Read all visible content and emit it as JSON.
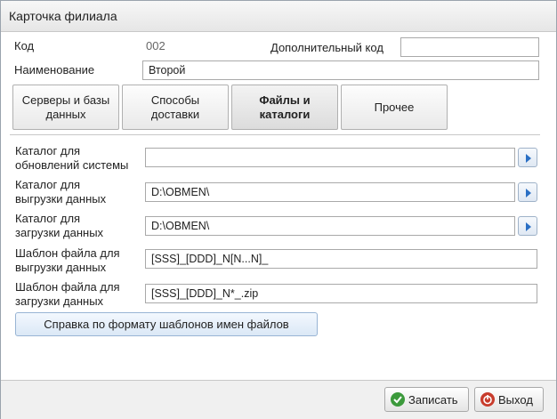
{
  "window": {
    "title": "Карточка филиала"
  },
  "header": {
    "code_label": "Код",
    "code_value": "002",
    "extra_code_label": "Дополнительный код",
    "extra_code_value": "",
    "name_label": "Наименование",
    "name_value": "Второй"
  },
  "tabs": [
    {
      "label_line1": "Серверы и базы",
      "label_line2": "данных"
    },
    {
      "label_line1": "Способы",
      "label_line2": "доставки"
    },
    {
      "label_line1": "Файлы и",
      "label_line2": "каталоги"
    },
    {
      "label_line1": "Прочее",
      "label_line2": ""
    }
  ],
  "fields": [
    {
      "label_line1": "Каталог для",
      "label_line2": "обновлений системы",
      "value": ""
    },
    {
      "label_line1": "Каталог для",
      "label_line2": "выгрузки данных",
      "value": "D:\\OBMEN\\"
    },
    {
      "label_line1": "Каталог для",
      "label_line2": "загрузки данных",
      "value": "D:\\OBMEN\\"
    },
    {
      "label_line1": "Шаблон файла для",
      "label_line2": "выгрузки данных",
      "value": "[SSS]_[DDD]_N[N...N]_"
    },
    {
      "label_line1": "Шаблон файла для",
      "label_line2": "загрузки данных",
      "value": "[SSS]_[DDD]_N*_.zip"
    }
  ],
  "help_button": "Справка по формату шаблонов имен файлов",
  "footer": {
    "save_label": "Записать",
    "exit_label": "Выход"
  },
  "icons": {
    "browse": "arrow-right-icon",
    "save": "check-icon",
    "exit": "power-icon"
  },
  "colors": {
    "browse_arrow": "#2a6fc4",
    "save_icon": "#3c9a3c",
    "exit_icon": "#c83c2c"
  }
}
